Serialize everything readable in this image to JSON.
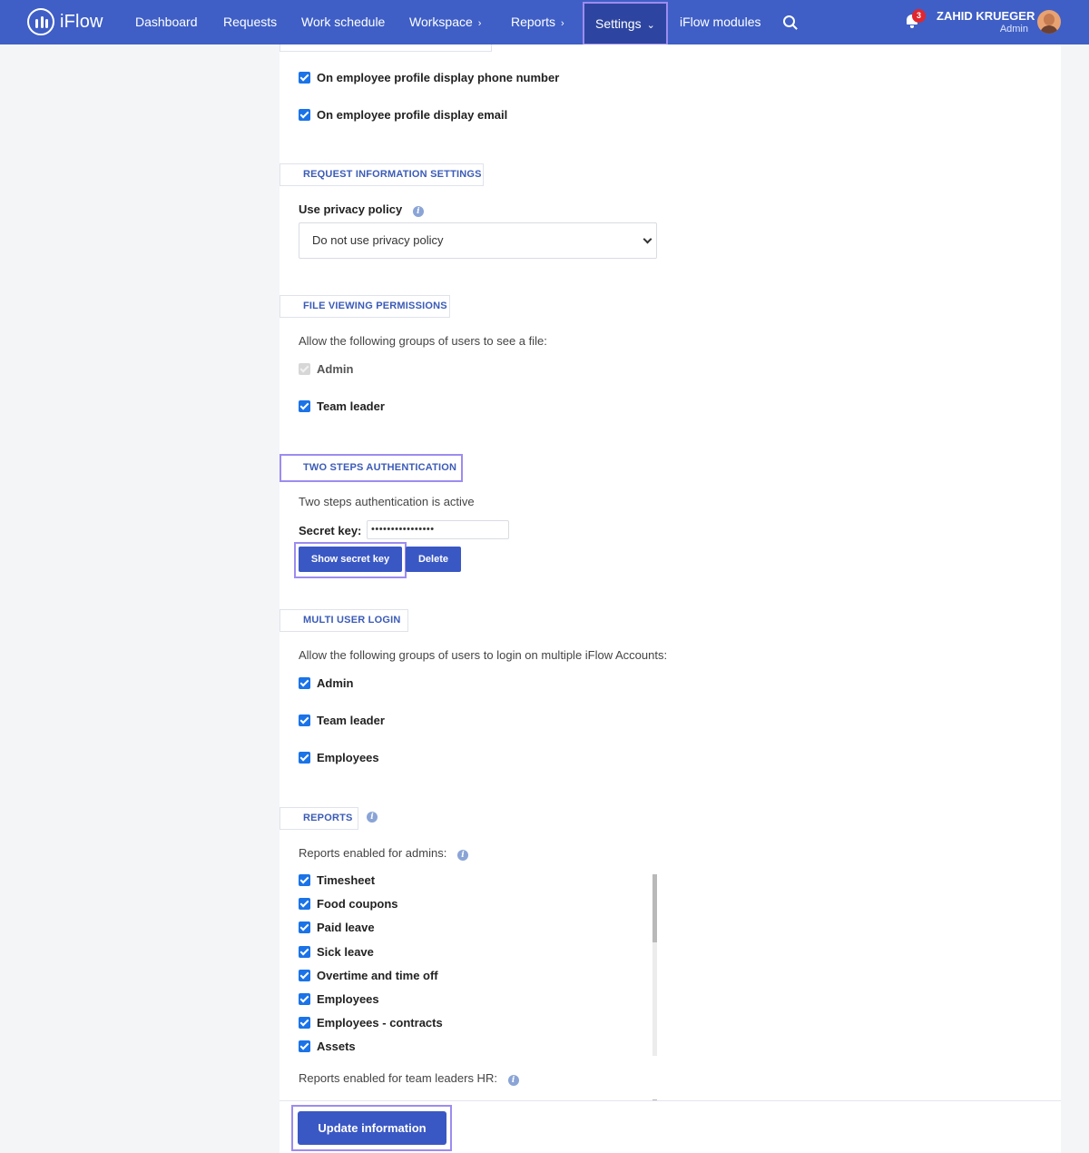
{
  "app": {
    "logo_text": "iFlow"
  },
  "nav": {
    "dashboard": "Dashboard",
    "requests": "Requests",
    "work_schedule": "Work schedule",
    "workspace": "Workspace",
    "reports": "Reports",
    "settings": "Settings",
    "modules": "iFlow modules",
    "notifications_count": "3",
    "user_name": "ZAHID KRUEGER",
    "user_role": "Admin"
  },
  "profile_settings": {
    "display_phone": "On employee profile display phone number",
    "display_email": "On employee profile display email"
  },
  "request_info": {
    "tab": "REQUEST INFORMATION SETTINGS",
    "privacy_label": "Use privacy policy",
    "privacy_value": "Do not use privacy policy"
  },
  "file_viewing": {
    "tab": "FILE VIEWING PERMISSIONS",
    "intro": "Allow the following groups of users to see a file:",
    "admin": "Admin",
    "team_leader": "Team leader"
  },
  "two_factor": {
    "tab": "TWO STEPS AUTHENTICATION",
    "status": "Two steps authentication is active",
    "secret_label": "Secret key:",
    "secret_value": "••••••••••••••••",
    "show_button": "Show secret key",
    "delete_button": "Delete"
  },
  "multi_login": {
    "tab": "MULTI USER LOGIN",
    "intro": "Allow the following groups of users to login on multiple iFlow Accounts:",
    "admin": "Admin",
    "team_leader": "Team leader",
    "employees": "Employees"
  },
  "reports": {
    "tab": "REPORTS",
    "admins_label": "Reports enabled for admins:",
    "admin_items": [
      "Timesheet",
      "Food coupons",
      "Paid leave",
      "Sick leave",
      "Overtime and time off",
      "Employees",
      "Employees - contracts",
      "Assets"
    ],
    "team_leaders_label": "Reports enabled for team leaders HR:"
  },
  "footer": {
    "update_button": "Update information"
  },
  "colors": {
    "primary": "#3f5fc6",
    "highlight": "#9c8cf0",
    "checkbox": "#1a73e8",
    "badge": "#e0262e"
  }
}
